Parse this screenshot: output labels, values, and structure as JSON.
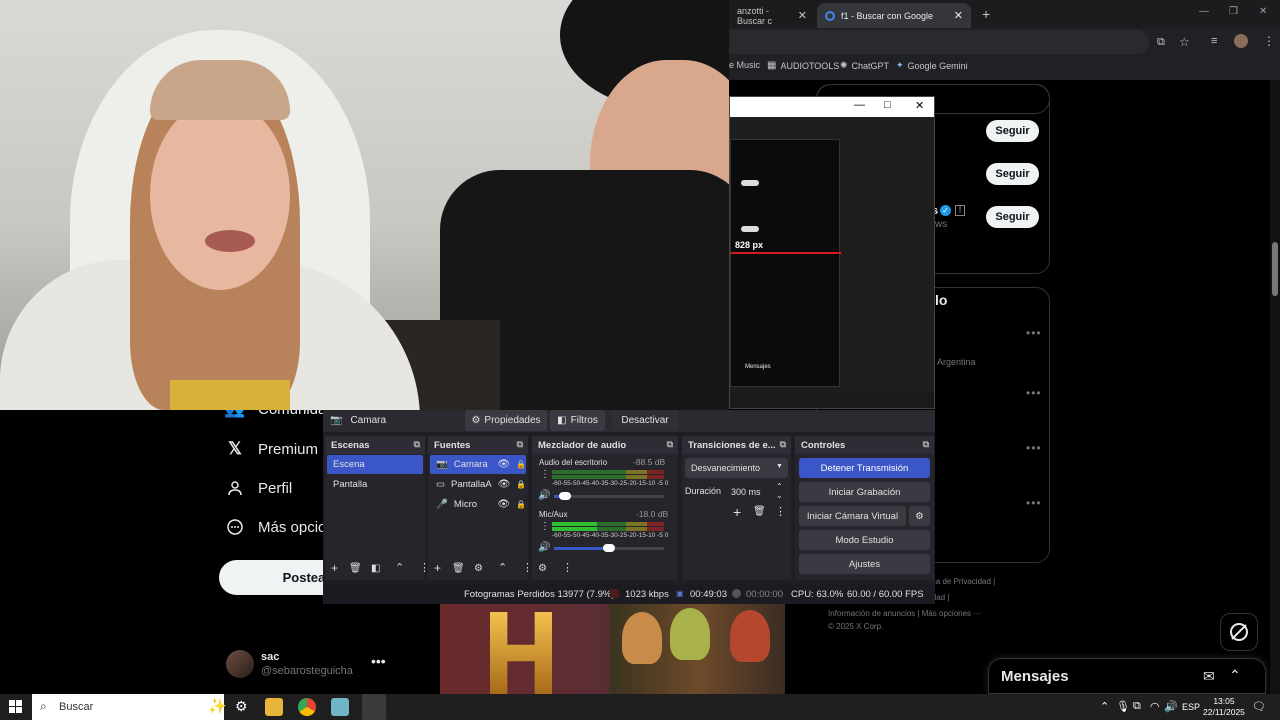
{
  "chrome": {
    "tabs": [
      {
        "title": "anzotti - Buscar c",
        "close": "✕"
      },
      {
        "title": "f1 - Buscar con Google",
        "close": "✕"
      }
    ],
    "new_tab": "+",
    "bookmarks": [
      "e Music",
      "AUDIOTOOLS",
      "ChatGPT",
      "Google Gemini"
    ]
  },
  "inner_window": {
    "px_label": "828 px",
    "messages_label": "Mensajes"
  },
  "x": {
    "nav": [
      {
        "icon": "people-icon",
        "label": "Comunidades"
      },
      {
        "icon": "x-logo-icon",
        "label": "Premium"
      },
      {
        "icon": "person-icon",
        "label": "Perfil"
      },
      {
        "icon": "more-circle-icon",
        "label": "Más opciones"
      }
    ],
    "post_label": "Postear",
    "profile": {
      "name": "sac",
      "handle": "@sebarosteguicha",
      "more": "•••"
    },
    "follow_label": "Seguir",
    "trend_heading": "lo",
    "trend_location": "Argentina",
    "follow_fragment_1": "s",
    "follow_fragment_2": "ws",
    "footer": {
      "line1": "ica de Privacidad |",
      "line2": "idad |",
      "line3": "Información de anuncios | Más opciones ···",
      "copyright": "© 2025 X Corp."
    },
    "messages_title": "Mensajes"
  },
  "obs": {
    "source_name": "Camara",
    "btn_properties": "Propiedades",
    "btn_filters": "Filtros",
    "btn_deactivate": "Desactivar",
    "scenes": {
      "title": "Escenas",
      "items": [
        "Escena",
        "Pantalla"
      ]
    },
    "sources": {
      "title": "Fuentes",
      "items": [
        "Camara",
        "PantallaA",
        "Micro"
      ]
    },
    "mixer": {
      "title": "Mezclador de audio",
      "channels": [
        {
          "name": "Audio del escritorio",
          "db": "-88.5 dB",
          "volume": 0.1
        },
        {
          "name": "Mic/Aux",
          "db": "-18.0 dB",
          "volume": 0.5
        }
      ],
      "scale": "-60-55-50-45-40-35-30-25-20-15-10 -5 0"
    },
    "transitions": {
      "title": "Transiciones de e...",
      "selected": "Desvanecimiento",
      "duration_label": "Duración",
      "duration_value": "300 ms"
    },
    "controls": {
      "title": "Controles",
      "buttons": [
        "Detener Transmisión",
        "Iniciar Grabación",
        "Iniciar Cámara Virtual",
        "Modo Estudio",
        "Ajustes"
      ]
    },
    "status": {
      "dropped": "Fotogramas Perdidos 13977 (7.9%)",
      "bitrate": "1023 kbps",
      "stream_time": "00:49:03",
      "rec_time": "00:00:00",
      "cpu": "CPU: 63.0%",
      "fps": "60.00 / 60.00 FPS"
    }
  },
  "taskbar": {
    "search": "Buscar",
    "lang": "ESP",
    "time": "13:05",
    "date": "22/11/2025"
  },
  "colors": {
    "obs_accent": "#3b56c7",
    "x_bg": "#000000",
    "chrome_bg": "#202124"
  }
}
